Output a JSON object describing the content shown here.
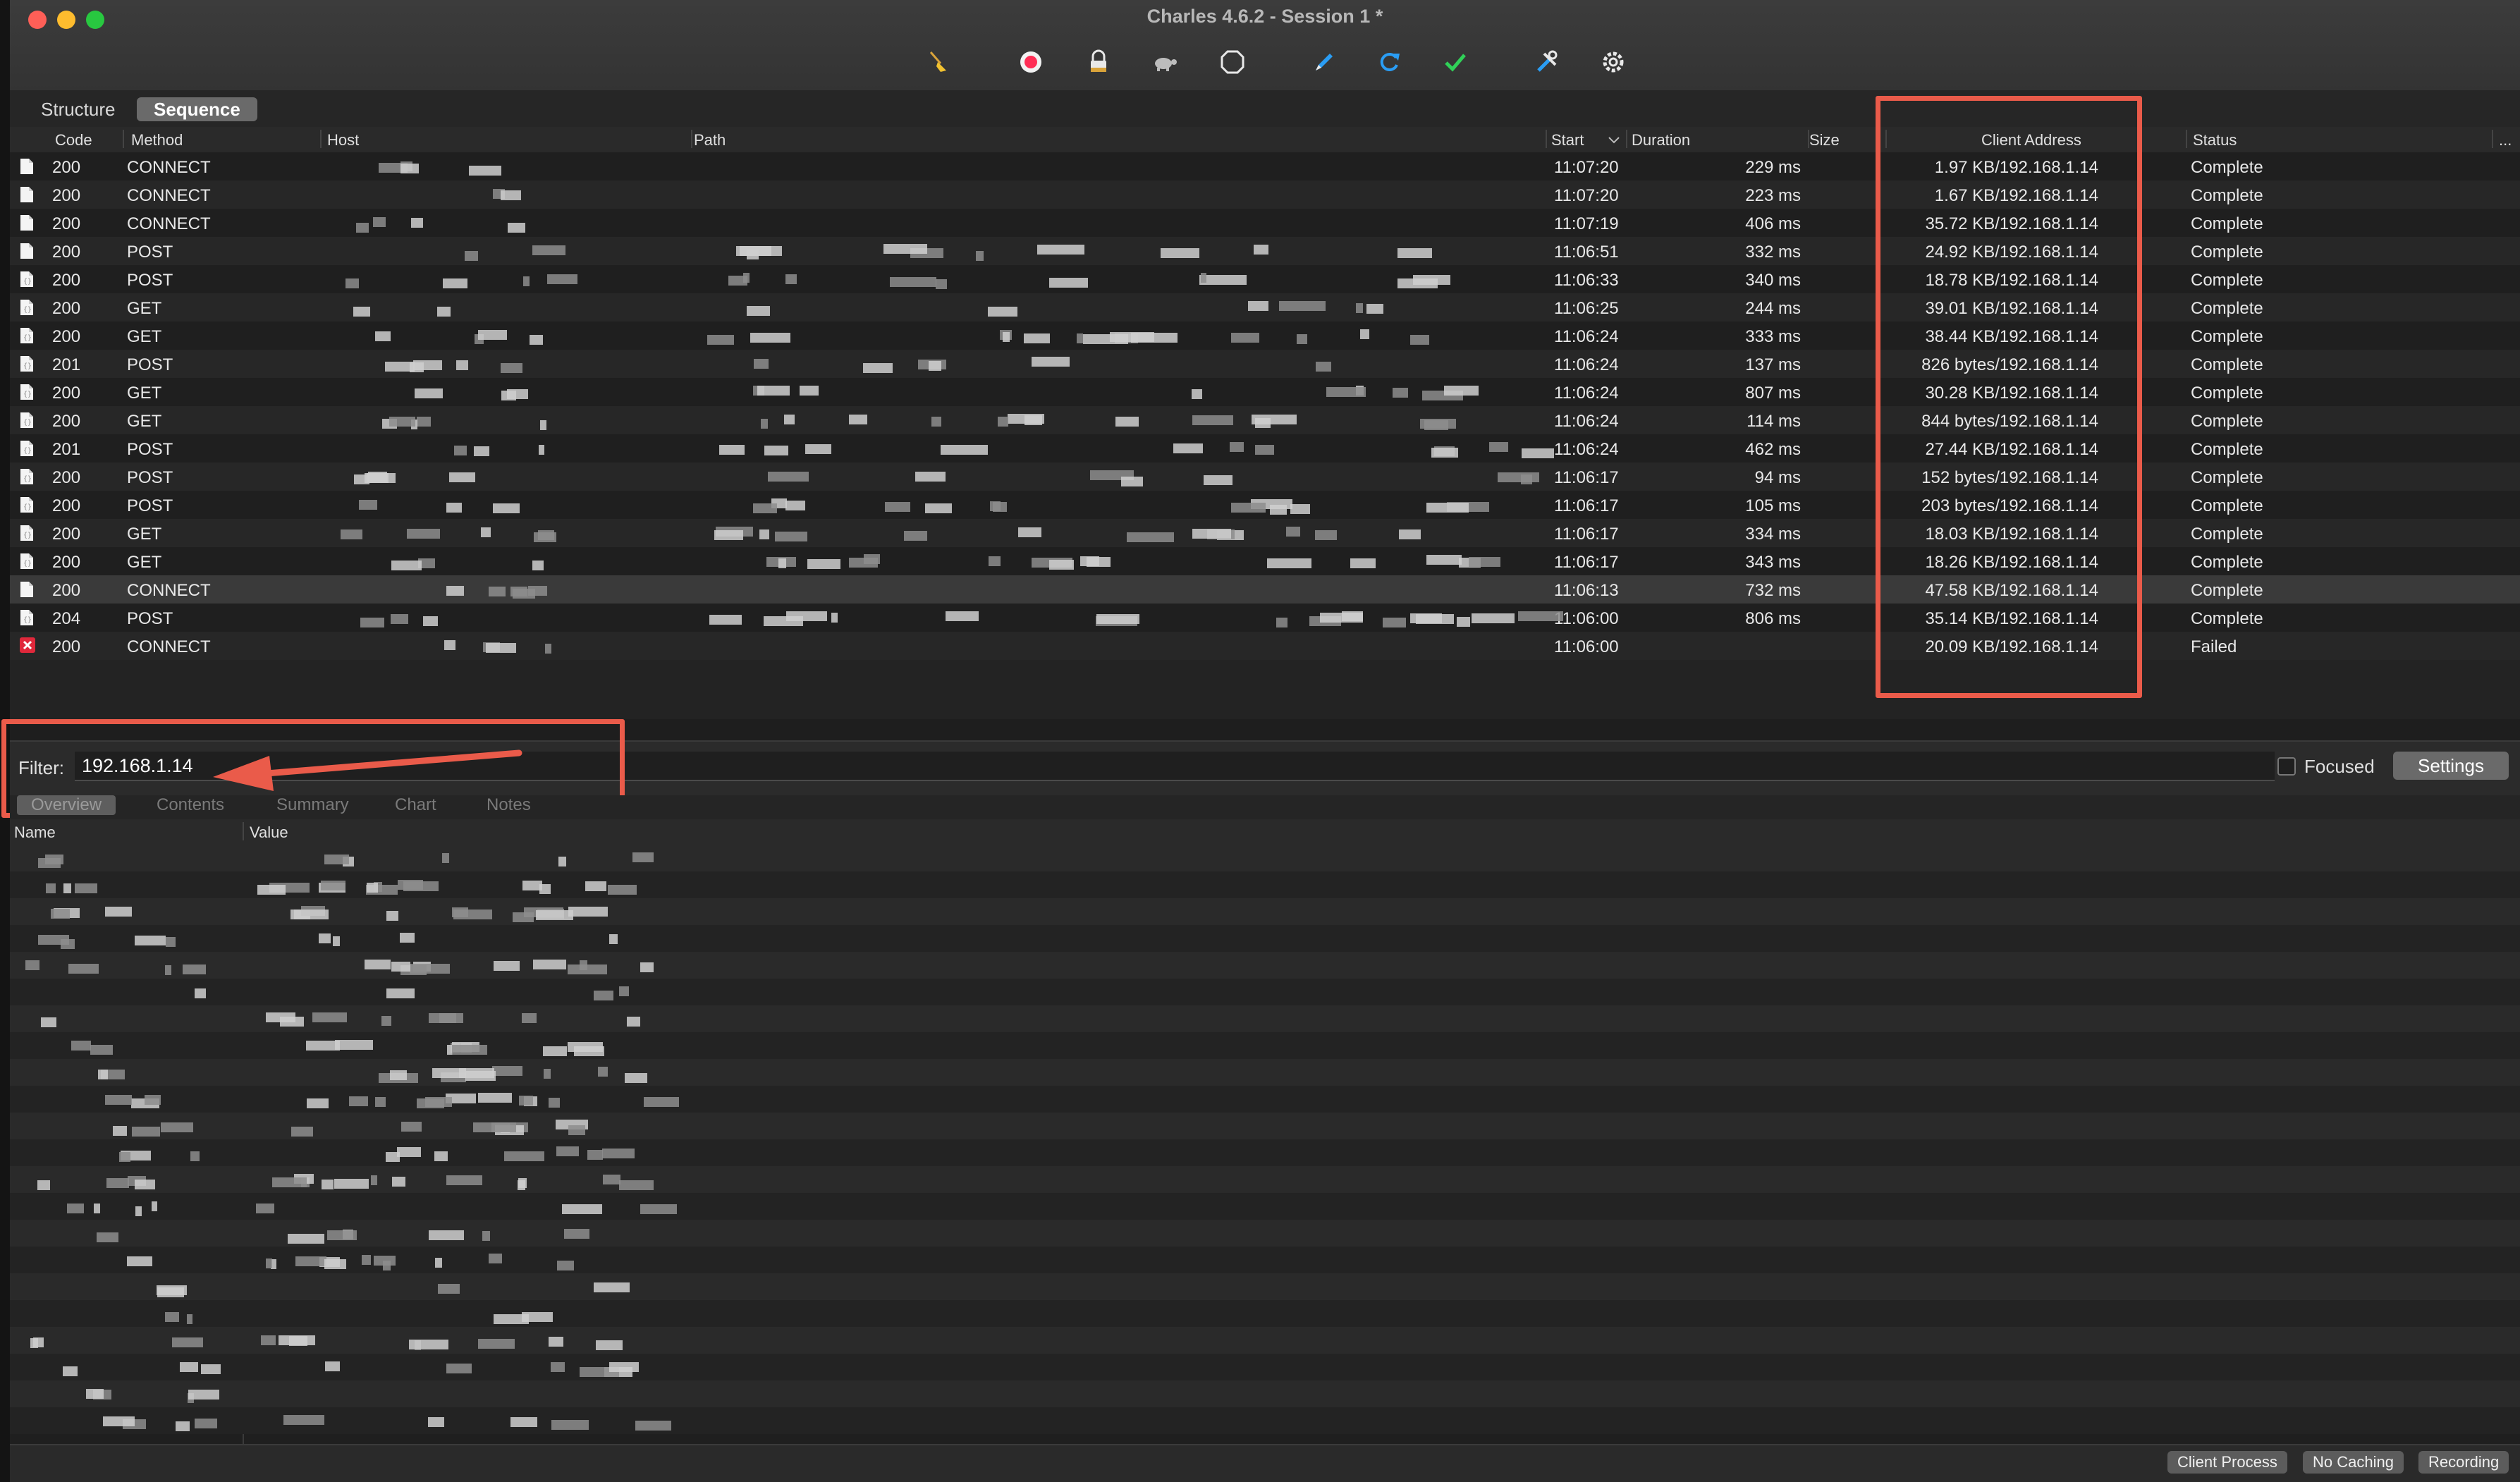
{
  "window": {
    "title": "Charles 4.6.2 - Session 1 *"
  },
  "toolbar": {
    "icons": [
      "broom-icon",
      "record-icon",
      "lock-icon",
      "turtle-icon",
      "stop-icon",
      "pen-icon",
      "refresh-icon",
      "check-icon",
      "tools-icon",
      "gear-icon"
    ]
  },
  "view_tabs": {
    "structure": "Structure",
    "sequence": "Sequence"
  },
  "table": {
    "columns": {
      "code": "Code",
      "method": "Method",
      "host": "Host",
      "path": "Path",
      "start": "Start",
      "duration": "Duration",
      "size": "Size",
      "client": "Client Address",
      "status": "Status",
      "more": "..."
    },
    "rows": [
      {
        "code": "200",
        "method": "CONNECT",
        "start": "11:07:20",
        "duration": "229 ms",
        "client": "1.97 KB/192.168.1.14",
        "status": "Complete",
        "icon": "document-icon"
      },
      {
        "code": "200",
        "method": "CONNECT",
        "start": "11:07:20",
        "duration": "223 ms",
        "client": "1.67 KB/192.168.1.14",
        "status": "Complete",
        "icon": "document-icon"
      },
      {
        "code": "200",
        "method": "CONNECT",
        "start": "11:07:19",
        "duration": "406 ms",
        "client": "35.72 KB/192.168.1.14",
        "status": "Complete",
        "icon": "document-icon"
      },
      {
        "code": "200",
        "method": "POST",
        "start": "11:06:51",
        "duration": "332 ms",
        "client": "24.92 KB/192.168.1.14",
        "status": "Complete",
        "icon": "document-icon"
      },
      {
        "code": "200",
        "method": "POST",
        "start": "11:06:33",
        "duration": "340 ms",
        "client": "18.78 KB/192.168.1.14",
        "status": "Complete",
        "icon": "json-doc-icon"
      },
      {
        "code": "200",
        "method": "GET",
        "start": "11:06:25",
        "duration": "244 ms",
        "client": "39.01 KB/192.168.1.14",
        "status": "Complete",
        "icon": "json-doc-icon"
      },
      {
        "code": "200",
        "method": "GET",
        "start": "11:06:24",
        "duration": "333 ms",
        "client": "38.44 KB/192.168.1.14",
        "status": "Complete",
        "icon": "json-doc-icon"
      },
      {
        "code": "201",
        "method": "POST",
        "start": "11:06:24",
        "duration": "137 ms",
        "client": "826 bytes/192.168.1.14",
        "status": "Complete",
        "icon": "json-doc-icon"
      },
      {
        "code": "200",
        "method": "GET",
        "start": "11:06:24",
        "duration": "807 ms",
        "client": "30.28 KB/192.168.1.14",
        "status": "Complete",
        "icon": "json-doc-icon"
      },
      {
        "code": "200",
        "method": "GET",
        "start": "11:06:24",
        "duration": "114 ms",
        "client": "844 bytes/192.168.1.14",
        "status": "Complete",
        "icon": "json-doc-icon"
      },
      {
        "code": "201",
        "method": "POST",
        "start": "11:06:24",
        "duration": "462 ms",
        "client": "27.44 KB/192.168.1.14",
        "status": "Complete",
        "icon": "json-doc-icon"
      },
      {
        "code": "200",
        "method": "POST",
        "start": "11:06:17",
        "duration": "94 ms",
        "client": "152 bytes/192.168.1.14",
        "status": "Complete",
        "icon": "json-doc-icon"
      },
      {
        "code": "200",
        "method": "POST",
        "start": "11:06:17",
        "duration": "105 ms",
        "client": "203 bytes/192.168.1.14",
        "status": "Complete",
        "icon": "json-doc-icon"
      },
      {
        "code": "200",
        "method": "GET",
        "start": "11:06:17",
        "duration": "334 ms",
        "client": "18.03 KB/192.168.1.14",
        "status": "Complete",
        "icon": "json-doc-icon"
      },
      {
        "code": "200",
        "method": "GET",
        "start": "11:06:17",
        "duration": "343 ms",
        "client": "18.26 KB/192.168.1.14",
        "status": "Complete",
        "icon": "json-doc-icon"
      },
      {
        "code": "200",
        "method": "CONNECT",
        "start": "11:06:13",
        "duration": "732 ms",
        "client": "47.58 KB/192.168.1.14",
        "status": "Complete",
        "icon": "document-icon"
      },
      {
        "code": "204",
        "method": "POST",
        "start": "11:06:00",
        "duration": "806 ms",
        "client": "35.14 KB/192.168.1.14",
        "status": "Complete",
        "icon": "json-doc-icon"
      },
      {
        "code": "200",
        "method": "CONNECT",
        "start": "11:06:00",
        "duration": "",
        "client": "20.09 KB/192.168.1.14",
        "status": "Failed",
        "icon": "error-icon"
      }
    ]
  },
  "filter": {
    "label": "Filter:",
    "value": "192.168.1.14",
    "focused_label": "Focused",
    "settings_label": "Settings"
  },
  "detail": {
    "tabs": [
      "Overview",
      "Contents",
      "Summary",
      "Chart",
      "Notes"
    ],
    "columns": {
      "name": "Name",
      "value": "Value"
    }
  },
  "status_bar": {
    "client_process": "Client Process",
    "no_caching": "No Caching",
    "recording": "Recording"
  },
  "colors": {
    "highlight": "#ea5b4a",
    "accent_blue": "#2a9df4",
    "check_green": "#30d158",
    "record_red": "#ff2d55"
  }
}
